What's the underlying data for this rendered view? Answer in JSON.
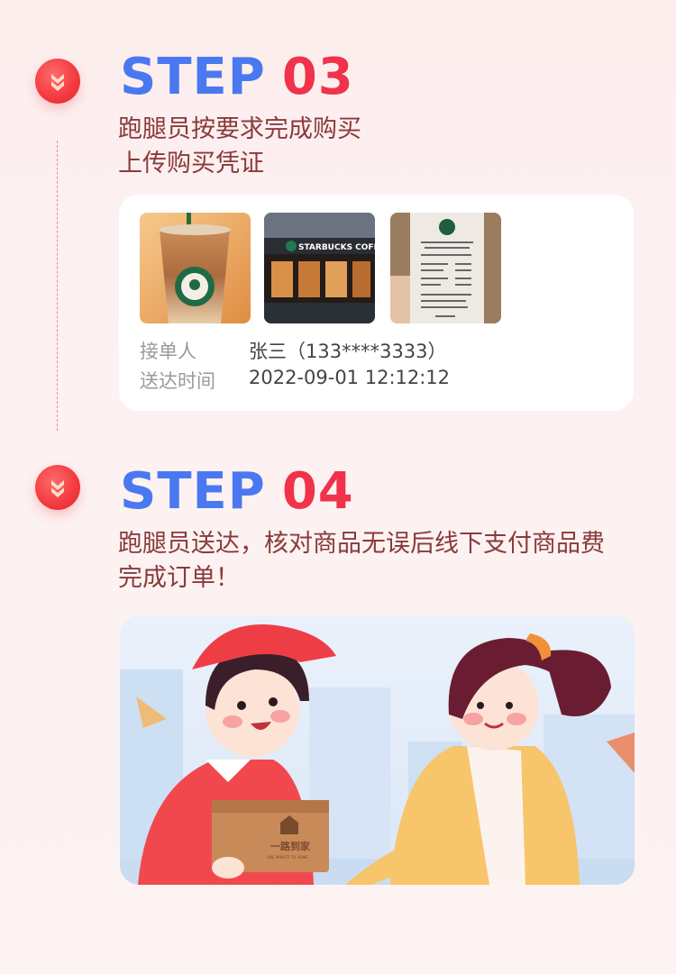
{
  "steps": [
    {
      "word": "STEP",
      "number": "03",
      "desc_line1": "跑腿员按要求完成购买",
      "desc_line2": "上传购买凭证"
    },
    {
      "word": "STEP",
      "number": "04",
      "desc_line1": "跑腿员送达，核对商品无误后线下支付商品费",
      "desc_line2": "完成订单！"
    }
  ],
  "order_card": {
    "photos": [
      {
        "name": "iced-coffee-photo",
        "sign_text": ""
      },
      {
        "name": "storefront-photo",
        "sign_text": "STARBUCKS COFFE"
      },
      {
        "name": "receipt-photo",
        "sign_text": ""
      }
    ],
    "receiver_label": "接单人",
    "receiver_value": "张三（133****3333）",
    "delivery_time_label": "送达时间",
    "delivery_time_value": "2022-09-01 12:12:12"
  },
  "illustration": {
    "box_brand": "一路到家",
    "box_brand_sub": "ONE MINUTE TO HOME"
  },
  "colors": {
    "step_word": "#4a78f0",
    "step_number": "#f0334a",
    "desc_text": "#8a3a3a",
    "badge": "#f2393f"
  }
}
